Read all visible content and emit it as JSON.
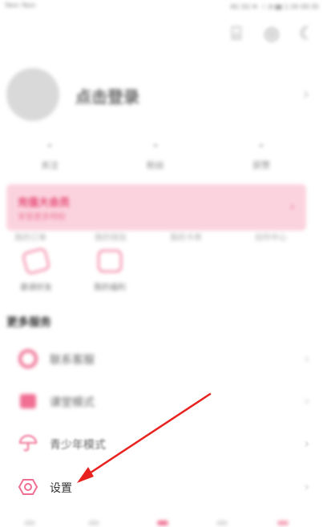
{
  "statusbar": {
    "carrier": "Yasn\nYasn",
    "right": "4G  5G  ✉  ☽  ◔  ▮▮  1:34  09:35"
  },
  "profile": {
    "login_label": "点击登录"
  },
  "stats": [
    {
      "value": "-",
      "label": "关注"
    },
    {
      "value": "-",
      "label": "粉丝"
    },
    {
      "value": "-",
      "label": "获赞"
    }
  ],
  "vip": {
    "title": "充值大会员",
    "subtitle": "享受更多特权"
  },
  "under_labels": [
    "我的订单",
    "我的钱包",
    "我的卡券",
    "创作中心"
  ],
  "grid2": [
    {
      "label": "邀请好友",
      "icon": "coupon-icon"
    },
    {
      "label": "我的福利",
      "icon": "gift-icon"
    }
  ],
  "section": {
    "title": "更多服务"
  },
  "menu": [
    {
      "label": "联系客服",
      "icon": "service-icon"
    },
    {
      "label": "课堂模式",
      "icon": "class-icon"
    },
    {
      "label": "青少年模式",
      "icon": "umbrella-icon"
    },
    {
      "label": "设置",
      "icon": "settings-icon"
    }
  ],
  "colors": {
    "accent": "#f06f93",
    "arrow": "#e8231f",
    "vip_bg": "#fbd3df"
  }
}
